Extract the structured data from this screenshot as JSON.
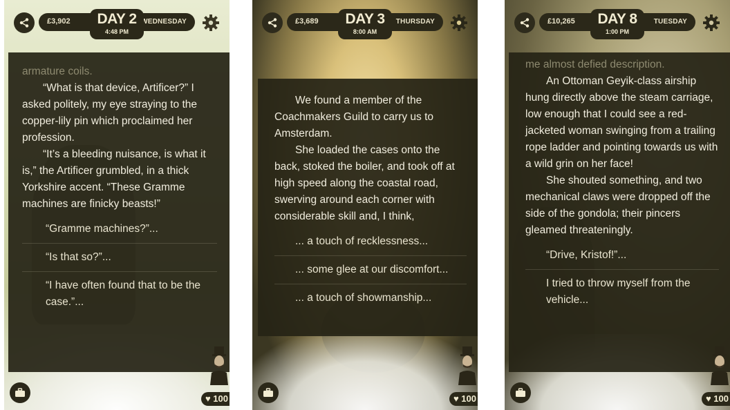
{
  "screens": [
    {
      "money": "£3,902",
      "day": "DAY 2",
      "time": "4:48 PM",
      "weekday": "WEDNESDAY",
      "paragraphs": [
        "armature coils.",
        "“What is that device, Artificer?” I asked politely, my eye straying to the copper-lily pin which proclaimed her profession.",
        "“It’s a bleeding nuisance, is what it is,” the Artificer grumbled, in a thick Yorkshire accent. “These Gramme machines are finicky beasts!”"
      ],
      "choices": [
        "“Gramme machines?”...",
        "“Is that so?”...",
        "“I have often found that to be the case.”..."
      ],
      "health": "♥ 100"
    },
    {
      "money": "£3,689",
      "day": "DAY 3",
      "time": "8:00 AM",
      "weekday": "THURSDAY",
      "paragraphs": [
        "We found a member of the Coachmakers Guild to carry us to Amsterdam.",
        "She loaded the cases onto the back, stoked the boiler, and took off at high speed along the coastal road, swerving around each corner with considerable skill and, I think,"
      ],
      "choices": [
        "... a touch of recklessness...",
        "... some glee at our discomfort...",
        "... a touch of showmanship..."
      ],
      "health": "♥ 100"
    },
    {
      "money": "£10,265",
      "day": "DAY 8",
      "time": "1:00 PM",
      "weekday": "TUESDAY",
      "paragraphs": [
        "me almost defied description.",
        "An Ottoman Geyik-class airship hung directly above the steam carriage, low enough that I could see a red-jacketed woman swinging from a trailing rope ladder and pointing towards us with a wild grin on her face!",
        "She shouted something, and two mechanical claws were dropped off the side of the gondola; their pincers gleamed threateningly."
      ],
      "choices": [
        "“Drive, Kristof!”...",
        "I tried to throw myself from the vehicle..."
      ],
      "health": "♥ 100"
    }
  ],
  "icons": {
    "share": "share-icon",
    "settings": "gear-icon",
    "luggage": "suitcase-icon",
    "health": "heart-icon"
  },
  "colors": {
    "hud": "#2b2819",
    "panel": "#262416",
    "text": "#f1edde"
  }
}
